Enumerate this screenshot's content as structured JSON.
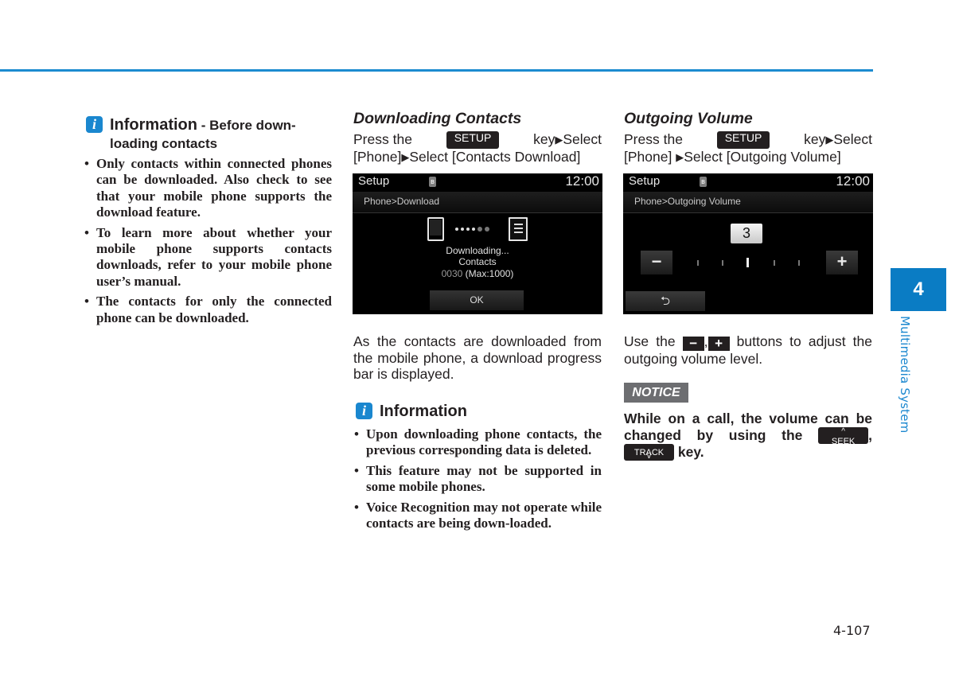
{
  "page": {
    "chapter_number": "4",
    "chapter_title": "Multimedia System",
    "page_number": "4-107",
    "accent_color": "#1a87cf"
  },
  "col1": {
    "info_icon": "info-icon",
    "info_title": "Information",
    "info_subtitle": " - Before down-loading contacts",
    "bullets": [
      "Only contacts within connected phones can be downloaded. Also check to see that your mobile phone supports the download feature.",
      "To learn more about whether your mobile phone supports contacts downloads, refer to your mobile phone user’s manual.",
      "The contacts for only the connected phone can be downloaded."
    ]
  },
  "col2": {
    "heading": "Downloading Contacts",
    "instr_press": "Press the",
    "instr_key": "SETUP",
    "instr_rest1": "key",
    "instr_arrow": "▶",
    "instr_select1": "Select",
    "instr_line2a": "[Phone]",
    "instr_line2b": "Select [Contacts Download]",
    "screen": {
      "title": "Setup",
      "time": "12:00",
      "path": "Phone>Download",
      "status1": "Downloading...",
      "status2": "Contacts",
      "count": "0030",
      "max": "(Max:1000)",
      "ok": "OK",
      "bt_icon": "ʙ"
    },
    "desc": "As the contacts are downloaded from the mobile phone, a download progress bar is displayed.",
    "info_title": "Information",
    "bullets": [
      "Upon downloading phone contacts, the previous corresponding data is deleted.",
      "This feature may not be supported in some mobile phones.",
      "Voice Recognition may not operate while contacts are being down-loaded."
    ]
  },
  "col3": {
    "heading": "Outgoing Volume",
    "instr_press": "Press the",
    "instr_key": "SETUP",
    "instr_rest1": "key",
    "instr_arrow": "▶",
    "instr_select1": "Select",
    "instr_line2a": "[Phone]",
    "instr_line2b": "Select [Outgoing Volume]",
    "screen": {
      "title": "Setup",
      "time": "12:00",
      "path": "Phone>Outgoing Volume",
      "volume": "3",
      "minus": "−",
      "plus": "+",
      "back": "⮌",
      "bt_icon": "ʙ"
    },
    "desc_a": "Use the",
    "desc_minus": "−",
    "desc_comma": ",",
    "desc_plus": "+",
    "desc_b": "buttons to adjust the outgoing volume level.",
    "notice_label": "NOTICE",
    "notice_a": "While on a call, the volume can be changed by using the",
    "seek_label": "SEEK",
    "seek_chev": "^",
    "track_label": "TRACK",
    "track_chev": "v",
    "notice_comma": ",",
    "notice_b": "key."
  }
}
